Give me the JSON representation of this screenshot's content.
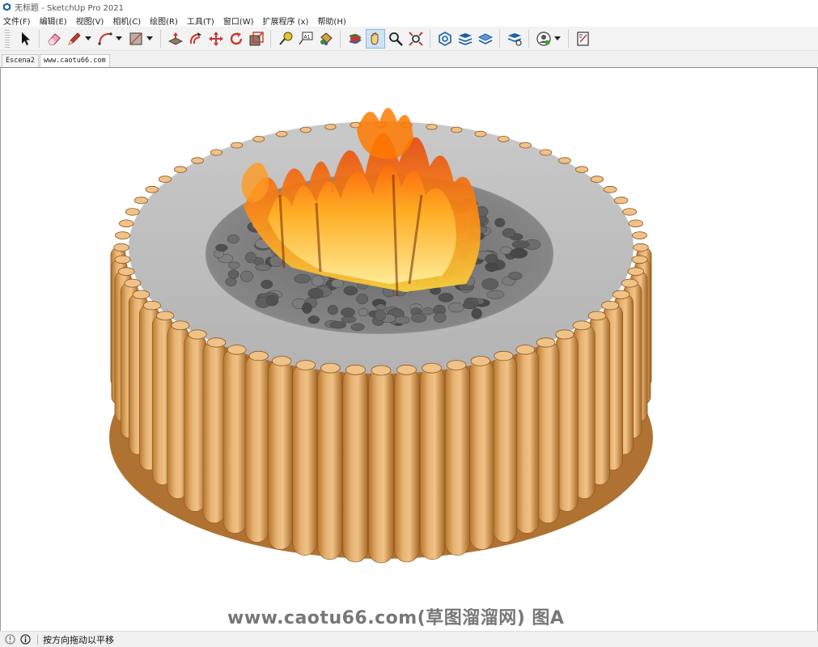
{
  "window": {
    "title": "无标题 - SketchUp Pro 2021",
    "app_icon": "sketchup-logo-icon"
  },
  "menu": [
    {
      "label": "文件(F)"
    },
    {
      "label": "编辑(E)"
    },
    {
      "label": "视图(V)"
    },
    {
      "label": "相机(C)"
    },
    {
      "label": "绘图(R)"
    },
    {
      "label": "工具(T)"
    },
    {
      "label": "窗口(W)"
    },
    {
      "label": "扩展程序 (x)"
    },
    {
      "label": "帮助(H)"
    }
  ],
  "toolbar": {
    "tools": [
      {
        "icon": "select-arrow-icon"
      },
      {
        "icon": "eraser-icon"
      },
      {
        "icon": "pencil-line-icon"
      },
      {
        "icon": "arc-icon"
      },
      {
        "icon": "rectangle-shape-icon"
      },
      {
        "icon": "push-pull-icon"
      },
      {
        "icon": "offset-icon"
      },
      {
        "icon": "move-icon"
      },
      {
        "icon": "rotate-icon"
      },
      {
        "icon": "scale-icon"
      },
      {
        "icon": "tape-measure-icon"
      },
      {
        "icon": "text-label-icon"
      },
      {
        "icon": "paint-bucket-icon"
      },
      {
        "icon": "orbit-icon"
      },
      {
        "icon": "pan-hand-icon",
        "active": true
      },
      {
        "icon": "zoom-icon"
      },
      {
        "icon": "zoom-extents-icon"
      },
      {
        "icon": "3d-warehouse-icon"
      },
      {
        "icon": "extension-warehouse-icon"
      },
      {
        "icon": "layout-icon"
      },
      {
        "icon": "extension-manager-icon"
      },
      {
        "icon": "account-icon"
      },
      {
        "icon": "send-to-layout-icon"
      }
    ]
  },
  "scene_tabs": [
    {
      "label": "Escena2",
      "active": false
    },
    {
      "label": "www.caotu66.com",
      "active": true
    }
  ],
  "viewport": {
    "model": "fire-pit-with-wood-log-ring",
    "colors": {
      "wood_light": "#e6b372",
      "wood_dark": "#b8772f",
      "concrete": "#bdbdbd",
      "stones": "#5e5e5e",
      "flame_orange": "#ff7a00",
      "flame_yellow": "#ffd23a"
    }
  },
  "watermark": "www.caotu66.com(草图溜溜网) 图A",
  "status": {
    "icons": [
      "geo-location-icon",
      "info-icon"
    ],
    "text": "按方向拖动以平移"
  }
}
